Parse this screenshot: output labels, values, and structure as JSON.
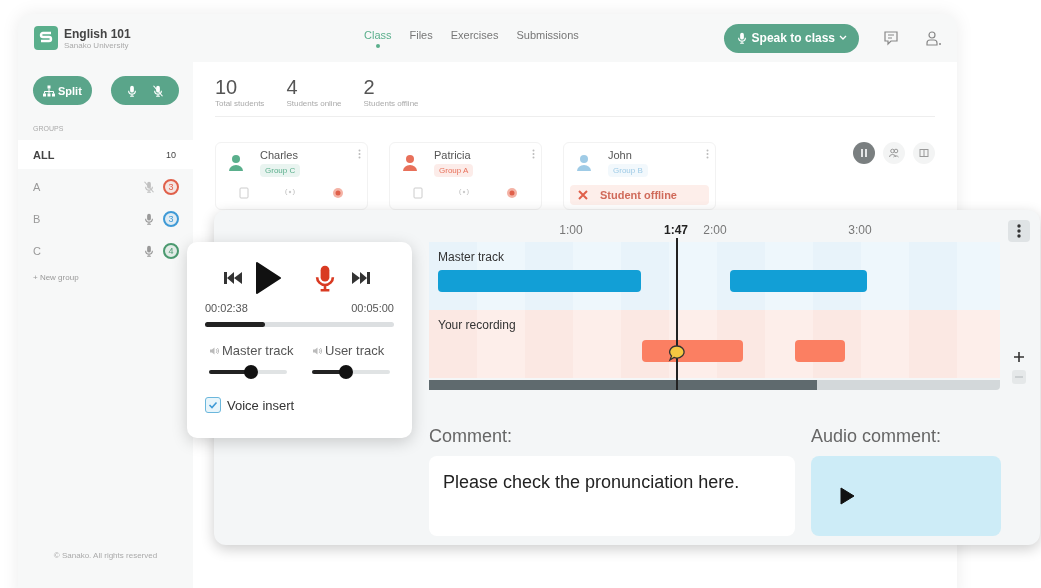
{
  "app": {
    "title": "English 101",
    "subtitle": "Sanako University"
  },
  "nav_tabs": [
    {
      "label": "Class",
      "selected": true
    },
    {
      "label": "Files",
      "selected": false
    },
    {
      "label": "Exercises",
      "selected": false
    },
    {
      "label": "Submissions",
      "selected": false
    }
  ],
  "speak_button": {
    "label": "Speak to class"
  },
  "sidebar": {
    "split_button": {
      "label": "Split"
    },
    "groups_heading": "GROUPS",
    "groups": [
      {
        "label": "ALL",
        "count": "10",
        "selected": true
      },
      {
        "label": "A",
        "count": "3",
        "selected": false,
        "mic_muted": true,
        "color": "#e0604a"
      },
      {
        "label": "B",
        "count": "3",
        "selected": false,
        "mic_muted": false,
        "color": "#3f9ad6"
      },
      {
        "label": "C",
        "count": "4",
        "selected": false,
        "mic_muted": false,
        "color": "#4c9a70"
      }
    ],
    "new_group": "+ New group",
    "footer": "© Sanako. All rights reserved"
  },
  "stats": [
    {
      "value": "10",
      "label": "Total students"
    },
    {
      "value": "4",
      "label": "Students online"
    },
    {
      "value": "2",
      "label": "Students offline"
    }
  ],
  "students": [
    {
      "name": "Charles",
      "group": "Group C",
      "color": "#5aaf8c",
      "offline": false
    },
    {
      "name": "Patricia",
      "group": "Group A",
      "color": "#e8705a",
      "offline": false
    },
    {
      "name": "John",
      "group": "Group B",
      "color": "#9fcbe6",
      "offline": true,
      "status": "Student offline"
    }
  ],
  "view_toggles": [
    {
      "selected": true
    },
    {
      "selected": false
    },
    {
      "selected": false
    }
  ],
  "editor": {
    "ticks": [
      {
        "label": "1:00",
        "kind": "tick"
      },
      {
        "label": "1:47",
        "kind": "playhead"
      },
      {
        "label": "2:00",
        "kind": "tick"
      },
      {
        "label": "3:00",
        "kind": "tick"
      }
    ],
    "tracks": [
      {
        "label": "Master track",
        "kind": "master"
      },
      {
        "label": "Your recording",
        "kind": "user"
      }
    ],
    "zoom_out_disabled": true,
    "comment_label": "Comment:",
    "comment": "Please check the pronunciation here.",
    "audio_comment_label": "Audio comment:"
  },
  "player": {
    "elapsed": "00:02:38",
    "total": "00:05:00",
    "level": 0.32,
    "volumes": [
      {
        "label": "Master track",
        "level": 0.54
      },
      {
        "label": "User track",
        "level": 0.43
      }
    ],
    "voice_insert": {
      "label": "Voice insert",
      "checked": true
    }
  }
}
